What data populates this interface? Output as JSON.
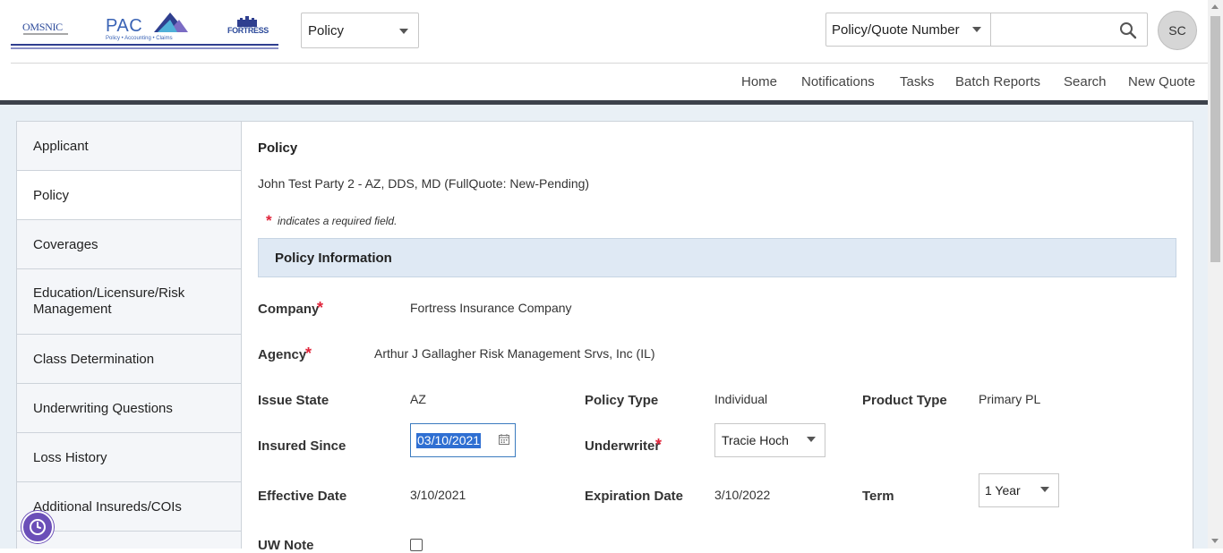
{
  "header": {
    "logos": {
      "omsnic": "OMSNIC",
      "pac": "PAC",
      "pac_tagline": "Policy • Accounting • Claims",
      "fortress": "FORTRESS"
    },
    "module_select": {
      "value": "Policy"
    },
    "search": {
      "type_value": "Policy/Quote Number",
      "placeholder": "",
      "icon": "search-icon"
    },
    "avatar_initials": "SC"
  },
  "nav": {
    "items": [
      "Home",
      "Notifications",
      "Tasks",
      "Batch Reports",
      "Search",
      "New Quote"
    ]
  },
  "sidebar": {
    "items": [
      {
        "label": "Applicant",
        "active": false
      },
      {
        "label": "Policy",
        "active": true
      },
      {
        "label": "Coverages",
        "active": false
      },
      {
        "label": "Education/Licensure/Risk Management",
        "active": false
      },
      {
        "label": "Class Determination",
        "active": false
      },
      {
        "label": "Underwriting Questions",
        "active": false
      },
      {
        "label": "Loss History",
        "active": false
      },
      {
        "label": "Additional Insureds/COIs",
        "active": false
      }
    ]
  },
  "main": {
    "title": "Policy",
    "subtitle": "John Test Party 2 - AZ, DDS, MD  (FullQuote:  New-Pending)",
    "required_star": "*",
    "required_note": "indicates a required field.",
    "section_title": "Policy Information",
    "fields": {
      "company": {
        "label": "Company",
        "value": "Fortress Insurance Company",
        "required": true
      },
      "agency": {
        "label": "Agency",
        "value": "Arthur J Gallagher Risk Management Srvs, Inc (IL)",
        "required": true
      },
      "issue_state": {
        "label": "Issue State",
        "value": "AZ"
      },
      "policy_type": {
        "label": "Policy Type",
        "value": "Individual"
      },
      "product_type": {
        "label": "Product Type",
        "value": "Primary PL"
      },
      "insured_since": {
        "label": "Insured Since",
        "value": "03/10/2021"
      },
      "underwriter": {
        "label": "Underwriter",
        "value": "Tracie Hoch",
        "required": true
      },
      "effective_date": {
        "label": "Effective Date",
        "value": "3/10/2021"
      },
      "expiration_date": {
        "label": "Expiration Date",
        "value": "3/10/2022"
      },
      "term": {
        "label": "Term",
        "value": "1 Year"
      },
      "uw_note": {
        "label": "UW Note",
        "checked": false
      }
    }
  },
  "colors": {
    "accent_blue": "#3b7bbf",
    "required_red": "#e0243a",
    "section_bg": "#dfe9f4",
    "help_fab": "#6b4fb8"
  }
}
